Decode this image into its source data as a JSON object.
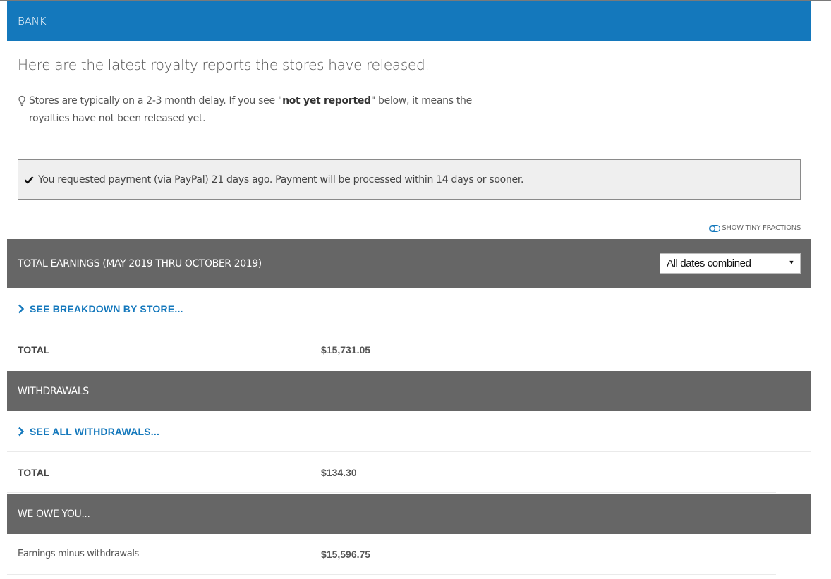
{
  "header": {
    "title": "BANK"
  },
  "intro": "Here are the latest royalty reports the stores have released.",
  "tip": {
    "icon": "lightbulb-icon",
    "text_before": "Stores are typically on a 2-3 month delay. If you see \"",
    "text_bold": "not yet reported",
    "text_after": "\" below, it means the royalties have not been released yet."
  },
  "notice": {
    "icon": "check-icon",
    "text": "You requested payment (via PayPal) 21 days ago. Payment will be processed within 14 days or sooner."
  },
  "toggle": {
    "icon": "toggle-icon",
    "label": "SHOW TINY FRACTIONS"
  },
  "earnings": {
    "title": "TOTAL EARNINGS (MAY 2019 THRU OCTOBER 2019)",
    "date_filter": {
      "selected": "All dates combined"
    },
    "breakdown_link": "SEE BREAKDOWN BY STORE...",
    "total_label": "TOTAL",
    "total_value": "$15,731.05"
  },
  "withdrawals": {
    "title": "WITHDRAWALS",
    "link": "SEE ALL WITHDRAWALS...",
    "total_label": "TOTAL",
    "total_value": "$134.30"
  },
  "owe": {
    "title": "WE OWE YOU...",
    "label": "Earnings minus withdrawals",
    "value": "$15,596.75"
  },
  "colors": {
    "header": "#1478bc",
    "section_bar": "#666666",
    "link": "#1478bc"
  }
}
